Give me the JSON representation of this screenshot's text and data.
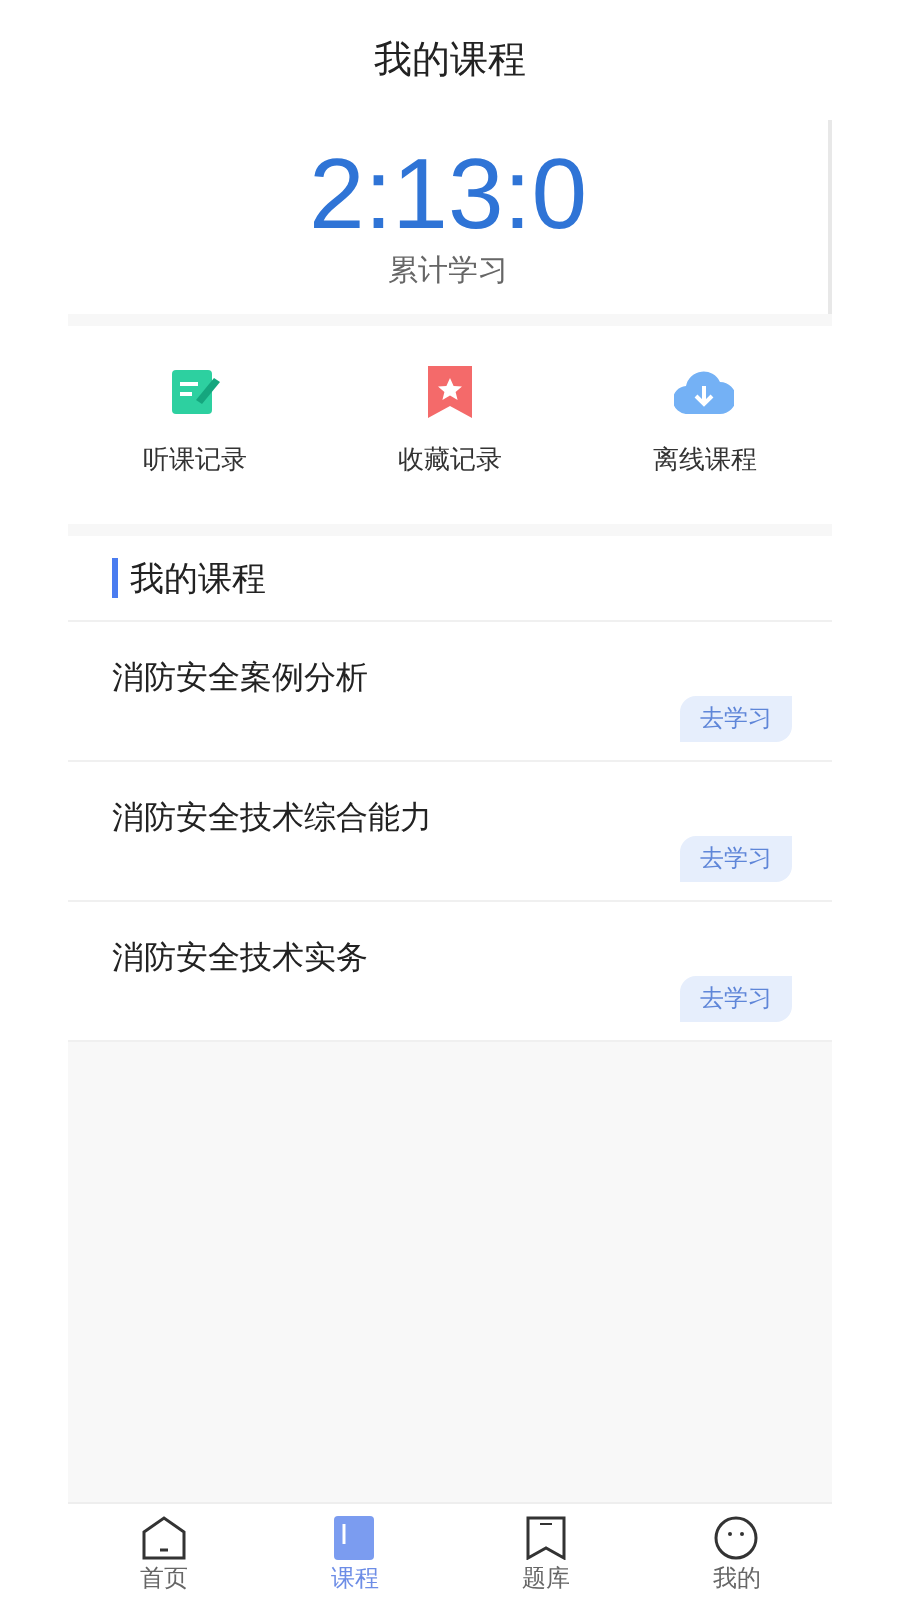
{
  "header": {
    "title": "我的课程"
  },
  "study_time": {
    "value": "2:13:0",
    "label": "累计学习"
  },
  "shortcuts": [
    {
      "kind": "notes",
      "label": "听课记录"
    },
    {
      "kind": "favorites",
      "label": "收藏记录"
    },
    {
      "kind": "offline",
      "label": "离线课程"
    }
  ],
  "section": {
    "title": "我的课程"
  },
  "courses": [
    {
      "title": "消防安全案例分析",
      "action": "去学习"
    },
    {
      "title": "消防安全技术综合能力",
      "action": "去学习"
    },
    {
      "title": "消防安全技术实务",
      "action": "去学习"
    }
  ],
  "tab_bar": [
    {
      "kind": "home",
      "label": "首页",
      "selected": false
    },
    {
      "kind": "courses",
      "label": "课程",
      "selected": true
    },
    {
      "kind": "questions",
      "label": "题库",
      "selected": false
    },
    {
      "kind": "profile",
      "label": "我的",
      "selected": false
    }
  ]
}
